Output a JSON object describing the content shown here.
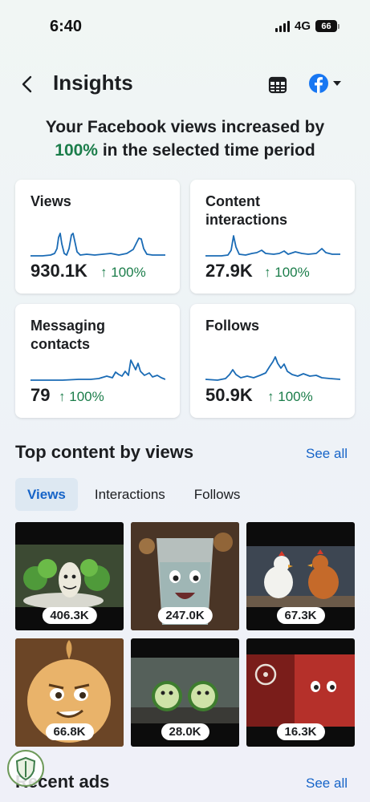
{
  "status": {
    "time": "6:40",
    "network": "4G",
    "battery": "66"
  },
  "header": {
    "title": "Insights",
    "back_icon": "chevron-left-icon",
    "table_icon": "table-icon",
    "account_icon": "facebook-icon"
  },
  "headline": {
    "prefix": "Your Facebook views increased by",
    "percent": "100%",
    "suffix": "in the selected time period"
  },
  "metrics": [
    {
      "title": "Views",
      "value": "930.1K",
      "change": "100%"
    },
    {
      "title": "Content interactions",
      "value": "27.9K",
      "change": "100%"
    },
    {
      "title": "Messaging contacts",
      "value": "79",
      "change": "100%"
    },
    {
      "title": "Follows",
      "value": "50.9K",
      "change": "100%"
    }
  ],
  "top_content": {
    "title": "Top content by views",
    "see_all": "See all",
    "tabs": [
      "Views",
      "Interactions",
      "Follows"
    ],
    "active_tab": 0,
    "items": [
      {
        "count": "406.3K",
        "scene": "broccoli-garlic"
      },
      {
        "count": "247.0K",
        "scene": "water-glass"
      },
      {
        "count": "67.3K",
        "scene": "chickens"
      },
      {
        "count": "66.8K",
        "scene": "onion"
      },
      {
        "count": "28.0K",
        "scene": "cucumbers"
      },
      {
        "count": "16.3K",
        "scene": "sausage-biohazard"
      }
    ]
  },
  "recent_ads": {
    "title": "Recent ads",
    "see_all": "See all"
  },
  "colors": {
    "accent": "#1664c8",
    "positive": "#1b7d4a",
    "facebook": "#1877f2",
    "spark": "#1a6bb5"
  }
}
